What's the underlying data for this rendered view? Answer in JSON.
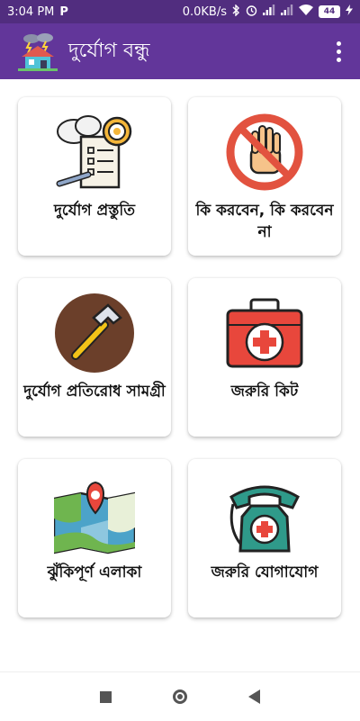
{
  "status_bar": {
    "time": "3:04 PM",
    "app_indicator": "P",
    "network_speed": "0.0KB/s",
    "battery_level": "44"
  },
  "app_bar": {
    "title": "দুর্যোগ বন্ধু",
    "colors": {
      "app_bar": "#62369a",
      "status_bar": "#512d7f"
    }
  },
  "menu": [
    {
      "label": "দুর্যোগ প্রস্তুতি",
      "icon": "checklist-gear-icon"
    },
    {
      "label": "কি করবেন, কি করবেন না",
      "icon": "stop-hand-icon"
    },
    {
      "label": "দুর্যোগ প্রতিরোধ সামগ্রী",
      "icon": "hammer-icon"
    },
    {
      "label": "জরুরি কিট",
      "icon": "first-aid-kit-icon"
    },
    {
      "label": "ঝুঁকিপূর্ণ এলাকা",
      "icon": "map-pin-icon"
    },
    {
      "label": "জরুরি যোগাযোগ",
      "icon": "emergency-phone-icon"
    }
  ]
}
